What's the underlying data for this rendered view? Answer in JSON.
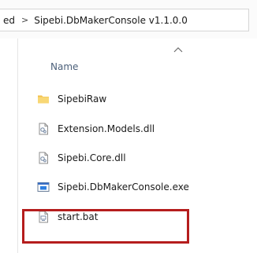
{
  "address": {
    "prev_crumb": "ed",
    "separator": ">",
    "current_folder": "Sipebi.DbMakerConsole v1.1.0.0"
  },
  "columns": {
    "name_header": "Name"
  },
  "files": [
    {
      "name": "SipebiRaw",
      "icon": "folder-icon"
    },
    {
      "name": "Extension.Models.dll",
      "icon": "dll-file-icon"
    },
    {
      "name": "Sipebi.Core.dll",
      "icon": "dll-file-icon"
    },
    {
      "name": "Sipebi.DbMakerConsole.exe",
      "icon": "exe-file-icon"
    },
    {
      "name": "start.bat",
      "icon": "bat-file-icon"
    }
  ],
  "colors": {
    "highlight": "#b51d1d",
    "folder": "#f2c14e",
    "header_text": "#4c607a"
  }
}
